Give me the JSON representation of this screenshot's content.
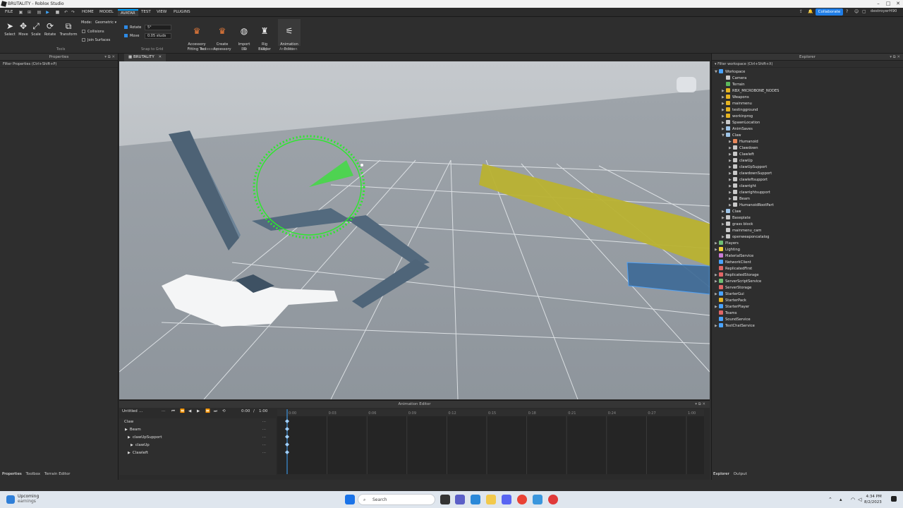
{
  "window": {
    "title": "BRUTALITY - Roblox Studio"
  },
  "menubar": {
    "file": "FILE",
    "tabs": [
      "HOME",
      "MODEL",
      "AVATAR",
      "TEST",
      "VIEW",
      "PLUGINS"
    ],
    "active_tab": "AVATAR",
    "collaborate": "Collaborate",
    "username": "destroyerH90"
  },
  "ribbon": {
    "tools": [
      "Select",
      "Move",
      "Scale",
      "Rotate",
      "Transform"
    ],
    "mode_label": "Mode:",
    "mode_value": "Geometric",
    "collisions": "Collisions",
    "join_surfaces": "Join Surfaces",
    "tools_group": "Tools",
    "rotate_label": "Rotate",
    "rotate_value": "5°",
    "move_label": "Move",
    "move_value": "0.05 studs",
    "snap_group": "Snap to Grid",
    "accessory_fitting": "Accessory\nFitting Tool",
    "create_accessory": "Create\nAccessory",
    "accessory_group": "Accessory",
    "import3d": "Import\n3D",
    "file_group": "File",
    "rig_builder": "Rig\nBuilder",
    "rig_group": "Rig",
    "animation_editor": "Animation\nEditor",
    "animation_group": "Animation"
  },
  "properties": {
    "title": "Properties",
    "filter": "Filter Properties (Ctrl+Shift+P)"
  },
  "doc_tab": "BRUTALITY",
  "animation_editor": {
    "title": "Animation Editor",
    "anim_name": "Untitled",
    "time_current": "0:00",
    "time_sep": "/",
    "time_total": "1:00",
    "rows": [
      {
        "label": "Claw",
        "indent": 0,
        "arrow": ""
      },
      {
        "label": "Beam",
        "indent": 1,
        "arrow": "▶"
      },
      {
        "label": "clawUpSupport",
        "indent": 2,
        "arrow": "▶"
      },
      {
        "label": "clawUp",
        "indent": 3,
        "arrow": "▶"
      },
      {
        "label": "Clawleft",
        "indent": 2,
        "arrow": "▶"
      }
    ],
    "ticks": [
      "0:00",
      "0:03",
      "0:06",
      "0:09",
      "0:12",
      "0:15",
      "0:18",
      "0:21",
      "0:24",
      "0:27",
      "1:00"
    ]
  },
  "explorer": {
    "title": "Explorer",
    "filter": "Filter workspace (Ctrl+Shift+X)",
    "nodes": [
      {
        "label": "Workspace",
        "depth": 0,
        "arrow": "▼",
        "color": "#4aa3ff"
      },
      {
        "label": "Camera",
        "depth": 1,
        "arrow": "",
        "color": "#c9c9c9"
      },
      {
        "label": "Terrain",
        "depth": 1,
        "arrow": "",
        "color": "#5cb85c"
      },
      {
        "label": "RBX_MICROBONE_NODES",
        "depth": 1,
        "arrow": "▶",
        "color": "#e6b422"
      },
      {
        "label": "Weapons",
        "depth": 1,
        "arrow": "▶",
        "color": "#e6b422"
      },
      {
        "label": "mainmenu",
        "depth": 1,
        "arrow": "▶",
        "color": "#e6b422"
      },
      {
        "label": "testingground",
        "depth": 1,
        "arrow": "▶",
        "color": "#e6b422"
      },
      {
        "label": "workinprog",
        "depth": 1,
        "arrow": "▶",
        "color": "#e6b422"
      },
      {
        "label": "SpawnLocation",
        "depth": 1,
        "arrow": "▶",
        "color": "#c9c9c9"
      },
      {
        "label": "AnimSaves",
        "depth": 1,
        "arrow": "▶",
        "color": "#9fc5e8"
      },
      {
        "label": "Claw",
        "depth": 1,
        "arrow": "▼",
        "color": "#9fc5e8"
      },
      {
        "label": "Humanoid",
        "depth": 2,
        "arrow": "▶",
        "color": "#e8875a"
      },
      {
        "label": "Clawdown",
        "depth": 2,
        "arrow": "▶",
        "color": "#c9c9c9"
      },
      {
        "label": "Clawleft",
        "depth": 2,
        "arrow": "▶",
        "color": "#c9c9c9"
      },
      {
        "label": "clawUp",
        "depth": 2,
        "arrow": "▶",
        "color": "#c9c9c9"
      },
      {
        "label": "clawUpSupport",
        "depth": 2,
        "arrow": "▶",
        "color": "#c9c9c9"
      },
      {
        "label": "clawdownSupport",
        "depth": 2,
        "arrow": "▶",
        "color": "#c9c9c9"
      },
      {
        "label": "clawleftsupport",
        "depth": 2,
        "arrow": "▶",
        "color": "#c9c9c9"
      },
      {
        "label": "clawright",
        "depth": 2,
        "arrow": "▶",
        "color": "#c9c9c9"
      },
      {
        "label": "clawrightsupport",
        "depth": 2,
        "arrow": "▶",
        "color": "#c9c9c9"
      },
      {
        "label": "Beam",
        "depth": 2,
        "arrow": "▶",
        "color": "#c9c9c9"
      },
      {
        "label": "HumanoidRootPart",
        "depth": 2,
        "arrow": "▶",
        "color": "#c9c9c9"
      },
      {
        "label": "Claw",
        "depth": 1,
        "arrow": "▶",
        "color": "#9fc5e8"
      },
      {
        "label": "Baseplate",
        "depth": 1,
        "arrow": "▶",
        "color": "#c9c9c9"
      },
      {
        "label": "grass block",
        "depth": 1,
        "arrow": "▶",
        "color": "#c9c9c9"
      },
      {
        "label": "mainmenu_cam",
        "depth": 1,
        "arrow": "",
        "color": "#c9c9c9"
      },
      {
        "label": "openweaponcatalog",
        "depth": 1,
        "arrow": "▶",
        "color": "#c9c9c9"
      },
      {
        "label": "Players",
        "depth": 0,
        "arrow": "▶",
        "color": "#6fbf73"
      },
      {
        "label": "Lighting",
        "depth": 0,
        "arrow": "▶",
        "color": "#f2d33b"
      },
      {
        "label": "MaterialService",
        "depth": 0,
        "arrow": "",
        "color": "#c97bd6"
      },
      {
        "label": "NetworkClient",
        "depth": 0,
        "arrow": "",
        "color": "#4aa3ff"
      },
      {
        "label": "ReplicatedFirst",
        "depth": 0,
        "arrow": "",
        "color": "#e06666"
      },
      {
        "label": "ReplicatedStorage",
        "depth": 0,
        "arrow": "▶",
        "color": "#e06666"
      },
      {
        "label": "ServerScriptService",
        "depth": 0,
        "arrow": "▶",
        "color": "#6fbf73"
      },
      {
        "label": "ServerStorage",
        "depth": 0,
        "arrow": "",
        "color": "#e06666"
      },
      {
        "label": "StarterGui",
        "depth": 0,
        "arrow": "▶",
        "color": "#4aa3ff"
      },
      {
        "label": "StarterPack",
        "depth": 0,
        "arrow": "",
        "color": "#e6b422"
      },
      {
        "label": "StarterPlayer",
        "depth": 0,
        "arrow": "▶",
        "color": "#4aa3ff"
      },
      {
        "label": "Teams",
        "depth": 0,
        "arrow": "",
        "color": "#e06666"
      },
      {
        "label": "SoundService",
        "depth": 0,
        "arrow": "",
        "color": "#4aa3ff"
      },
      {
        "label": "TextChatService",
        "depth": 0,
        "arrow": "▶",
        "color": "#4aa3ff"
      }
    ]
  },
  "bottom_tabs_left": [
    "Properties",
    "Toolbox",
    "Terrain Editor"
  ],
  "bottom_tabs_right": [
    "Explorer",
    "Output"
  ],
  "taskbar": {
    "widget_title": "Upcoming",
    "widget_sub": "earnings",
    "search": "Search",
    "time": "4:34 PM",
    "date": "8/2/2023"
  }
}
